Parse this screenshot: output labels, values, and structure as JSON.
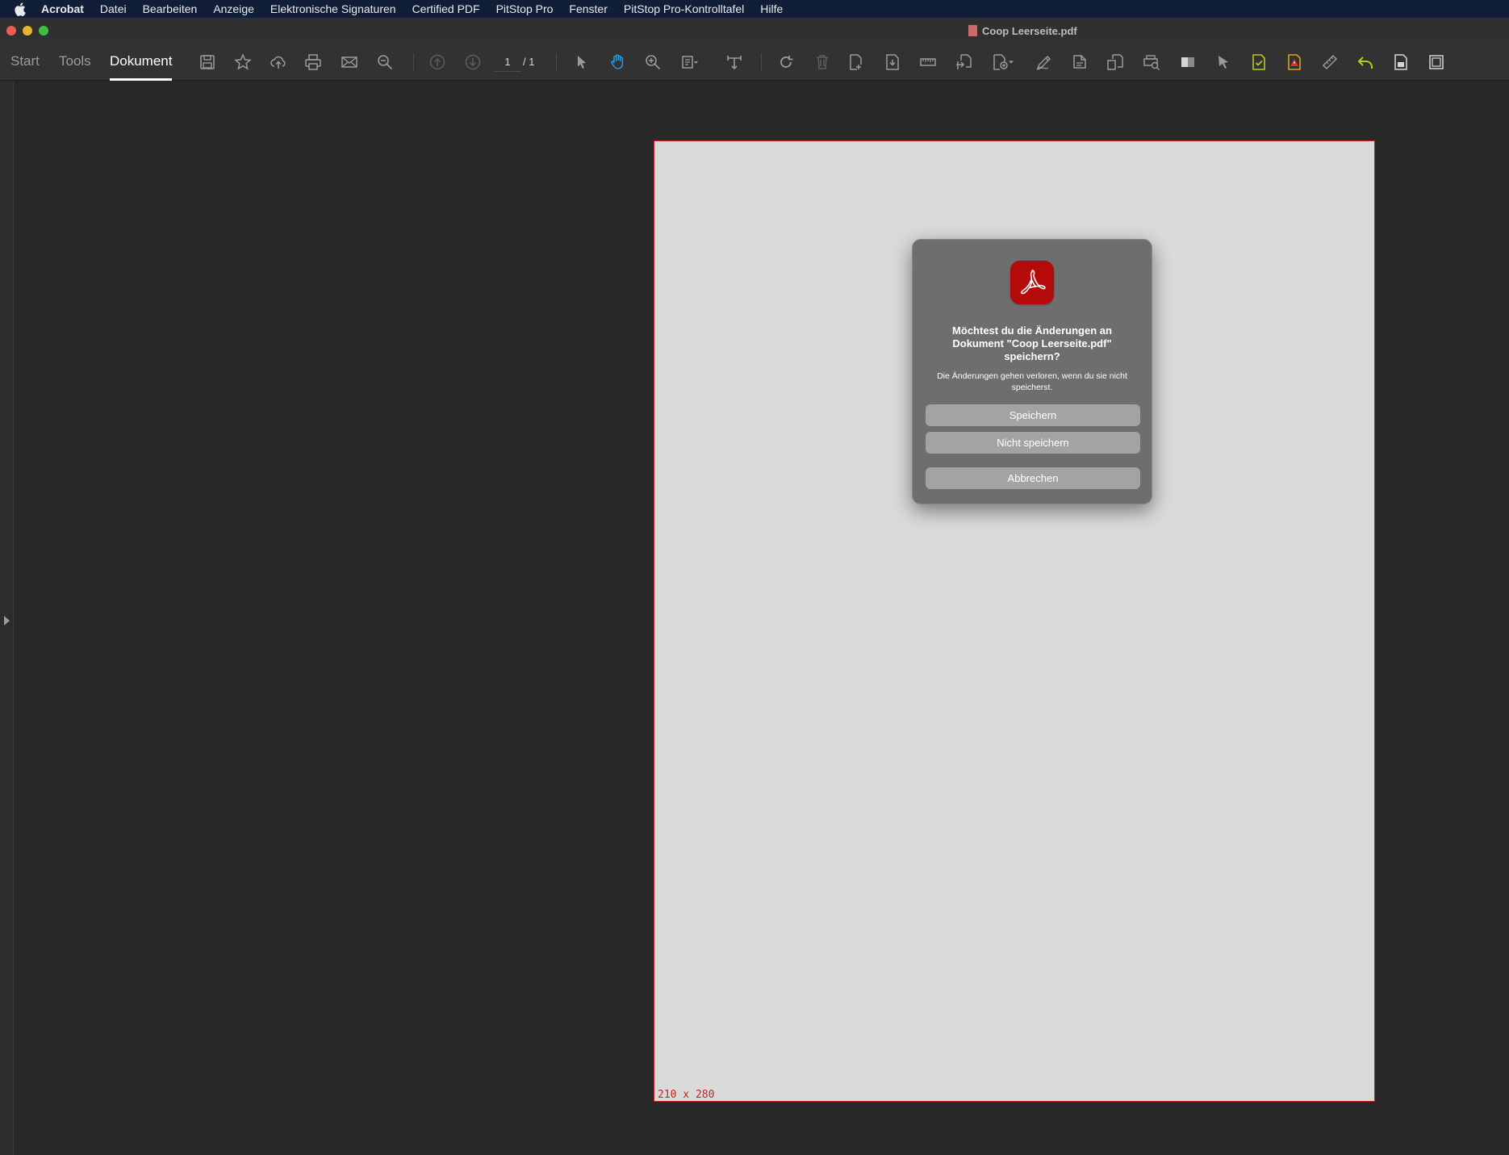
{
  "menubar": {
    "app": "Acrobat",
    "items": [
      "Datei",
      "Bearbeiten",
      "Anzeige",
      "Elektronische Signaturen",
      "Certified PDF",
      "PitStop Pro",
      "Fenster",
      "PitStop Pro-Kontrolltafel",
      "Hilfe"
    ]
  },
  "window": {
    "title": "Coop Leerseite.pdf"
  },
  "toolbar": {
    "tabs": [
      {
        "label": "Start",
        "active": false
      },
      {
        "label": "Tools",
        "active": false
      },
      {
        "label": "Dokument",
        "active": true
      }
    ],
    "page_current": "1",
    "page_total": "/ 1",
    "icons": [
      "save-icon",
      "bookmark-star-icon",
      "cloud-upload-icon",
      "print-icon",
      "email-icon",
      "zoom-search-icon",
      "page-up-icon",
      "page-down-icon",
      "select-arrow-icon",
      "hand-tool-icon",
      "zoom-in-icon",
      "fit-page-icon",
      "marquee-icon",
      "rotate-icon",
      "delete-icon",
      "page-extract-icon",
      "page-insert-icon",
      "ruler-measure-icon",
      "page-move-icon",
      "page-add-icon",
      "pen-edit-icon",
      "tag-edit-icon",
      "page-replace-icon",
      "print-preview-icon",
      "color-box-icon",
      "pointer-icon",
      "preflight-ok-icon",
      "preflight-warning-icon",
      "measure-tool-icon",
      "undo-icon",
      "document-icon",
      "frame-icon"
    ],
    "active_icon": "hand-tool-icon",
    "accent_color": "#1a9bf0"
  },
  "document": {
    "page_size_label": "210 x 280"
  },
  "dialog": {
    "heading": "Möchtest du die Änderungen an Dokument \"Coop Leerseite.pdf\" speichern?",
    "message": "Die Änderungen gehen verloren, wenn du sie nicht speicherst.",
    "buttons": {
      "save": "Speichern",
      "dont_save": "Nicht speichern",
      "cancel": "Abbrechen"
    }
  }
}
